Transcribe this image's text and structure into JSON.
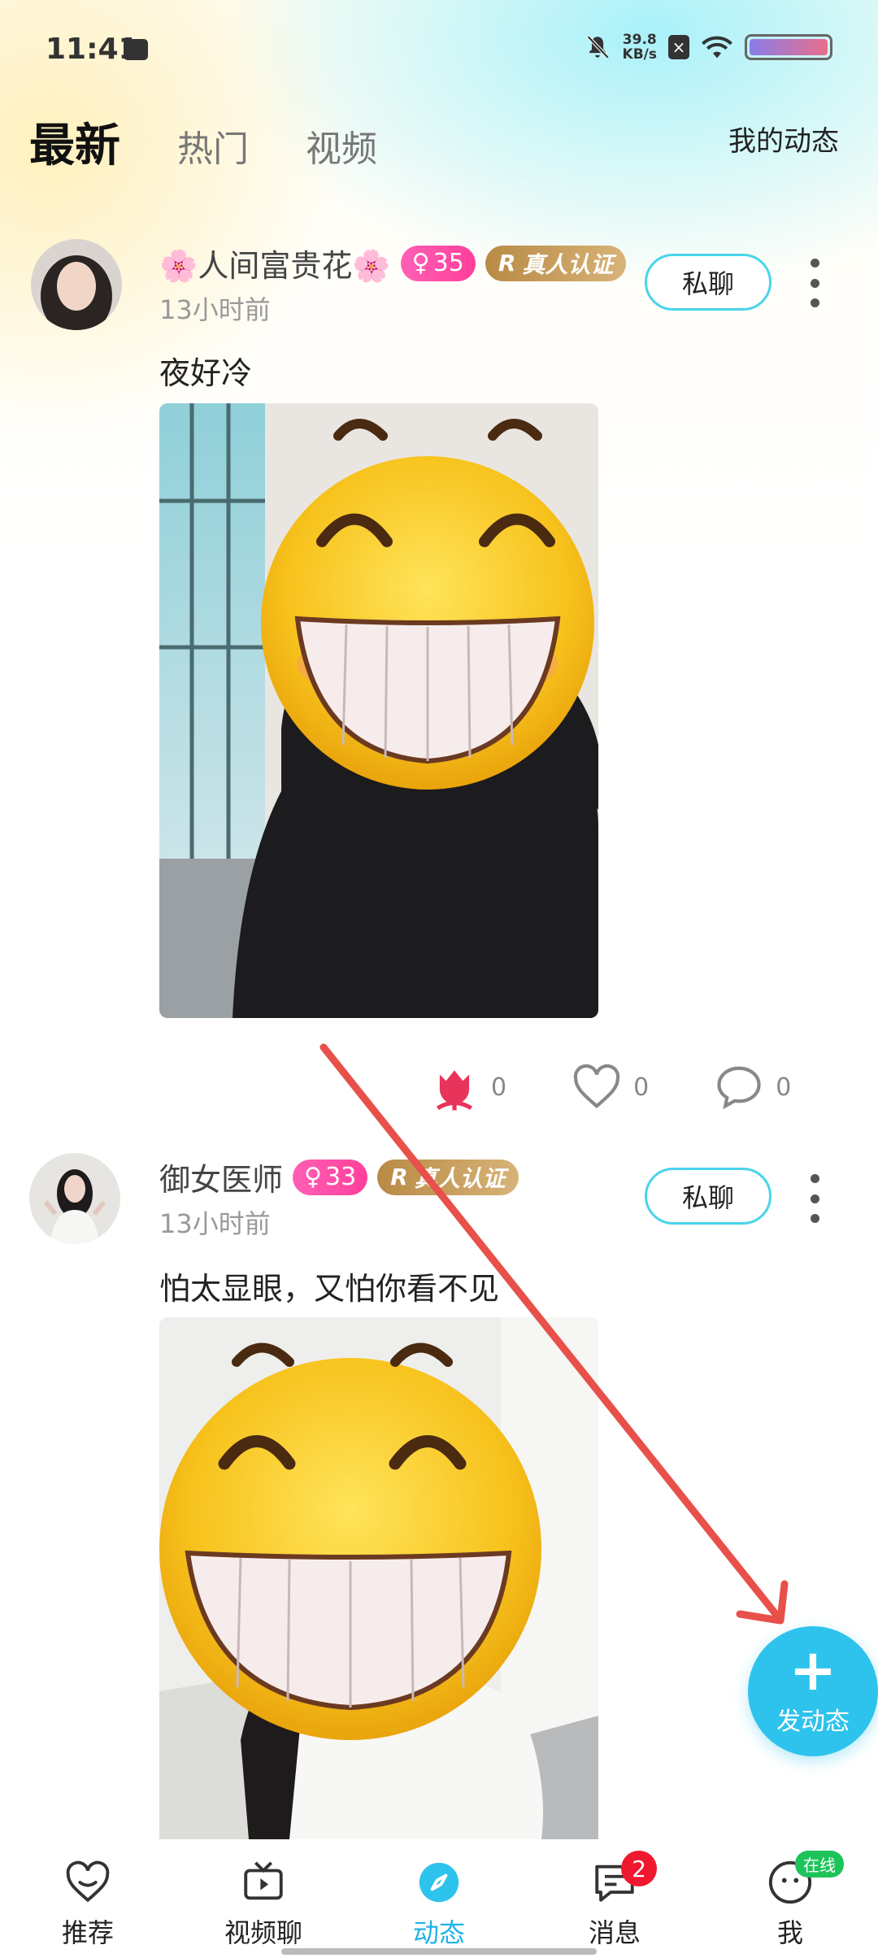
{
  "status_bar": {
    "time": "11:41",
    "net_speed_value": "39.8",
    "net_speed_unit": "KB/s"
  },
  "header": {
    "tabs": [
      {
        "label": "最新",
        "active": true
      },
      {
        "label": "热门",
        "active": false
      },
      {
        "label": "视频",
        "active": false
      }
    ],
    "my_dynamic_label": "我的动态"
  },
  "posts": [
    {
      "username": "🌸人间富贵花🌸",
      "level": "35",
      "verify_label": "真人认证",
      "time": "13小时前",
      "chat_label": "私聊",
      "text": "夜好冷",
      "flower_count": "0",
      "like_count": "0",
      "comment_count": "0"
    },
    {
      "username": "御女医师",
      "level": "33",
      "verify_label": "真人认证",
      "time": "13小时前",
      "chat_label": "私聊",
      "text": "怕太显眼，又怕你看不见"
    }
  ],
  "fab": {
    "label": "发动态"
  },
  "bottom_nav": {
    "items": [
      {
        "label": "推荐",
        "icon": "heart-face-icon"
      },
      {
        "label": "视频聊",
        "icon": "tv-icon"
      },
      {
        "label": "动态",
        "icon": "compass-icon",
        "active": true
      },
      {
        "label": "消息",
        "icon": "message-icon",
        "badge": "2"
      },
      {
        "label": "我",
        "icon": "face-icon",
        "status": "在线"
      }
    ]
  },
  "colors": {
    "accent": "#2ec3ec",
    "level_badge": "#ff3f9a",
    "verify_badge": "#c9a060",
    "notification": "#f0182f",
    "online": "#1ec35a",
    "overlay_arrow": "#e8504a"
  }
}
